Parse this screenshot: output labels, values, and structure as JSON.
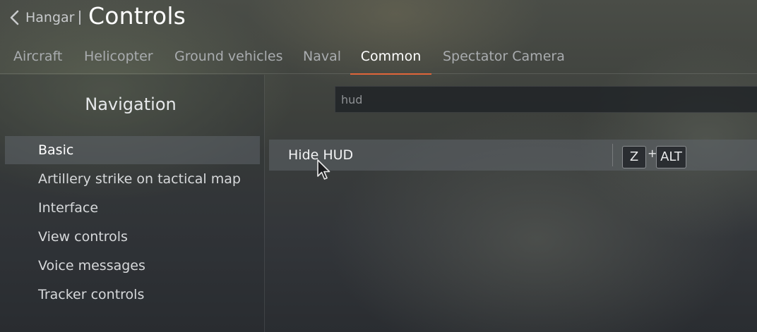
{
  "header": {
    "back_label": "Hangar",
    "title": "Controls"
  },
  "tabs": [
    {
      "label": "Aircraft",
      "active": false
    },
    {
      "label": "Helicopter",
      "active": false
    },
    {
      "label": "Ground vehicles",
      "active": false
    },
    {
      "label": "Naval",
      "active": false
    },
    {
      "label": "Common",
      "active": true
    },
    {
      "label": "Spectator Camera",
      "active": false
    }
  ],
  "sidebar": {
    "title": "Navigation",
    "items": [
      {
        "label": "Basic",
        "active": true
      },
      {
        "label": "Artillery strike on tactical map",
        "active": false
      },
      {
        "label": "Interface",
        "active": false
      },
      {
        "label": "View controls",
        "active": false
      },
      {
        "label": "Voice messages",
        "active": false
      },
      {
        "label": "Tracker controls",
        "active": false
      }
    ]
  },
  "search": {
    "value": "hud",
    "placeholder": ""
  },
  "results": [
    {
      "label": "Hide HUD",
      "keys": [
        "Z",
        "ALT"
      ],
      "key_separator": "+"
    }
  ],
  "colors": {
    "accent": "#e0653a"
  }
}
